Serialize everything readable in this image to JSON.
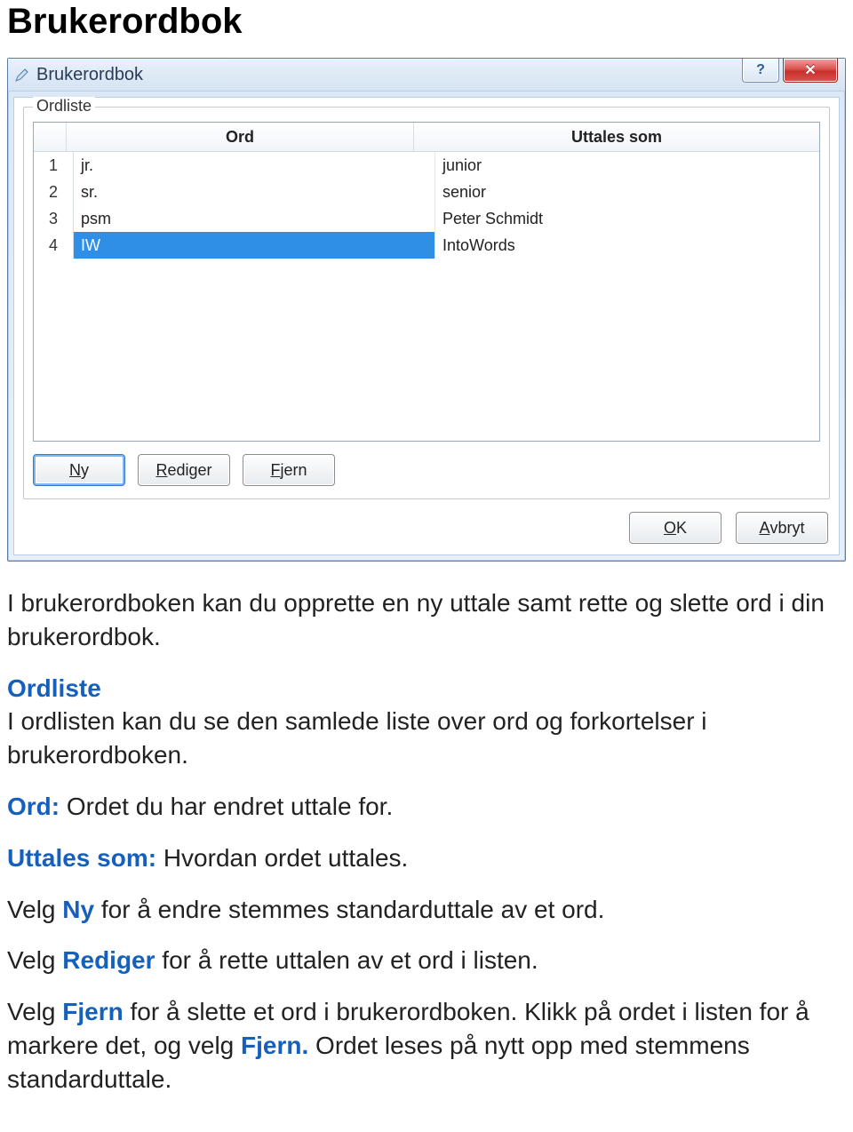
{
  "page_title": "Brukerordbok",
  "window": {
    "title": "Brukerordbok",
    "group_legend": "Ordliste",
    "columns": {
      "ord": "Ord",
      "uttales_som": "Uttales som"
    },
    "rows": [
      {
        "n": "1",
        "ord": "jr.",
        "utt": "junior"
      },
      {
        "n": "2",
        "ord": "sr.",
        "utt": "senior"
      },
      {
        "n": "3",
        "ord": "psm",
        "utt": "Peter Schmidt"
      },
      {
        "n": "4",
        "ord": "IW",
        "utt": "IntoWords"
      }
    ],
    "buttons": {
      "ny_u": "N",
      "ny_rest": "y",
      "rediger_u": "R",
      "rediger_rest": "ediger",
      "fjern_u": "F",
      "fjern_rest": "jern",
      "ok_u": "O",
      "ok_rest": "K",
      "avbryt_u": "A",
      "avbryt_rest": "vbryt"
    }
  },
  "body": {
    "intro": "I brukerordboken kan du opprette en ny uttale samt rette og slette ord i din brukerordbok.",
    "ordliste_head": "Ordliste",
    "ordliste_body": "I ordlisten kan du se den samlede liste over ord og forkortelser i brukerordboken.",
    "ord_label": "Ord:",
    "ord_body": " Ordet du har endret uttale for.",
    "uttales_label": "Uttales som:",
    "uttales_body": " Hvordan ordet uttales.",
    "ny_pre": "Velg ",
    "ny_kw": "Ny",
    "ny_post": " for å endre stemmes standarduttale av et ord.",
    "rediger_pre": "Velg ",
    "rediger_kw": "Rediger",
    "rediger_post": " for å rette uttalen av et ord i listen.",
    "fjern_pre": "Velg ",
    "fjern_kw": "Fjern",
    "fjern_post1": " for å slette et ord i brukerordboken. Klikk på ordet i listen for å markere det, og velg ",
    "fjern_kw2": "Fjern.",
    "fjern_post2": " Ordet leses på nytt opp med stemmens standarduttale."
  }
}
